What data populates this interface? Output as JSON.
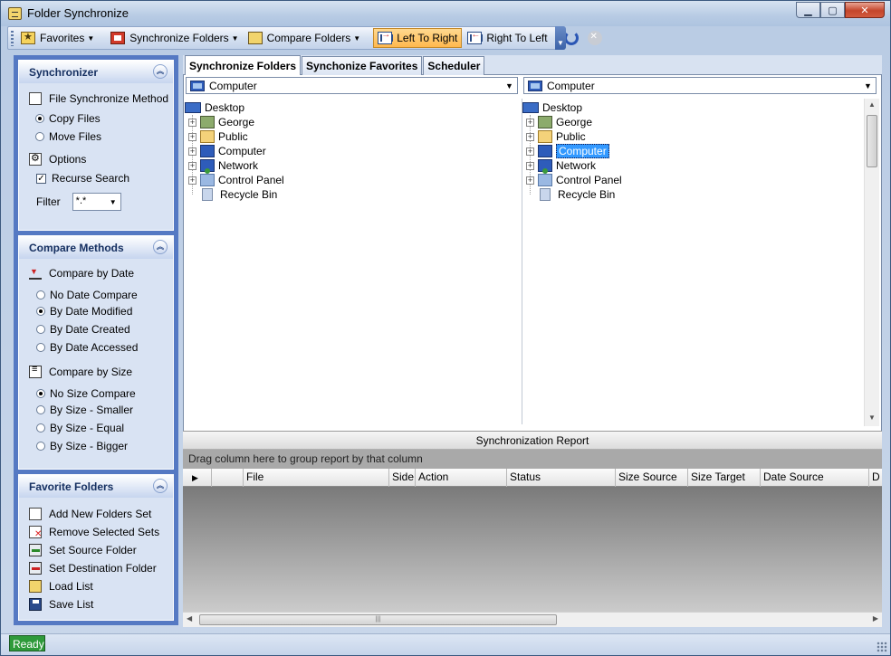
{
  "window": {
    "title": "Folder Synchronize"
  },
  "toolbar": {
    "favorites": "Favorites",
    "sync_folders": "Synchronize Folders",
    "compare_folders": "Compare Folders",
    "left_to_right": "Left To Right",
    "right_to_left": "Right To Left"
  },
  "synchronizer": {
    "header": "Synchronizer",
    "method_label": "File Synchronize Method",
    "copy_files": "Copy Files",
    "move_files": "Move Files",
    "options_label": "Options",
    "recurse_search": "Recurse Search",
    "filter_label": "Filter",
    "filter_value": "*.*"
  },
  "compare": {
    "header": "Compare Methods",
    "by_date_label": "Compare by Date",
    "date_options": [
      "No Date Compare",
      "By Date Modified",
      "By Date Created",
      "By Date Accessed"
    ],
    "date_selected": 1,
    "by_size_label": "Compare by Size",
    "size_options": [
      "No Size Compare",
      "By Size - Smaller",
      "By Size - Equal",
      "By Size - Bigger"
    ],
    "size_selected": 0
  },
  "favorites_panel": {
    "header": "Favorite Folders",
    "items": [
      "Add New Folders Set",
      "Remove Selected Sets",
      "Set Source Folder",
      "Set Destination Folder",
      "Load List",
      "Save List"
    ]
  },
  "tabs": [
    "Synchronize Folders",
    "Synchonize Favorites",
    "Scheduler"
  ],
  "left_browser": {
    "location": "Computer",
    "root": "Desktop",
    "nodes": [
      "George",
      "Public",
      "Computer",
      "Network",
      "Control Panel",
      "Recycle Bin"
    ]
  },
  "right_browser": {
    "location": "Computer",
    "root": "Desktop",
    "nodes": [
      "George",
      "Public",
      "Computer",
      "Network",
      "Control Panel",
      "Recycle Bin"
    ],
    "selected": "Computer"
  },
  "report": {
    "title": "Synchronization Report",
    "groupby_hint": "Drag column here to group report by that column",
    "columns": [
      "File",
      "Side",
      "Action",
      "Status",
      "Size Source",
      "Size Target",
      "Date Source",
      "D"
    ]
  },
  "status": {
    "text": "Ready"
  }
}
